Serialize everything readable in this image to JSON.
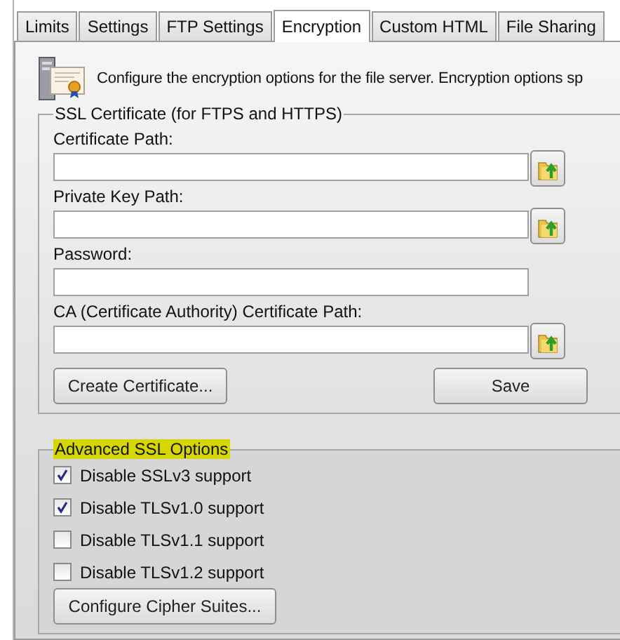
{
  "tabs": [
    {
      "label": "Limits",
      "selected": false
    },
    {
      "label": "Settings",
      "selected": false
    },
    {
      "label": "FTP Settings",
      "selected": false
    },
    {
      "label": "Encryption",
      "selected": true
    },
    {
      "label": "Custom HTML",
      "selected": false
    },
    {
      "label": "File Sharing",
      "selected": false
    }
  ],
  "description": "Configure the encryption options for the file server. Encryption options sp",
  "ssl_certificate": {
    "title": "SSL Certificate (for FTPS and HTTPS)",
    "fields": [
      {
        "label": "Certificate Path:",
        "browse": true
      },
      {
        "label": "Private Key Path:",
        "browse": true
      },
      {
        "label": "Password:",
        "browse": false
      },
      {
        "label": "CA (Certificate Authority) Certificate Path:",
        "browse": true
      }
    ],
    "buttons": [
      "Create Certificate...",
      "Save"
    ]
  },
  "advanced_ssl": {
    "title": "Advanced SSL Options",
    "highlighted": true,
    "options": [
      {
        "label": "Disable SSLv3 support",
        "checked": true
      },
      {
        "label": "Disable TLSv1.0 support",
        "checked": true
      },
      {
        "label": "Disable TLSv1.1 support",
        "checked": false
      },
      {
        "label": "Disable TLSv1.2 support",
        "checked": false
      }
    ],
    "buttons": [
      "Configure Cipher Suites..."
    ]
  }
}
